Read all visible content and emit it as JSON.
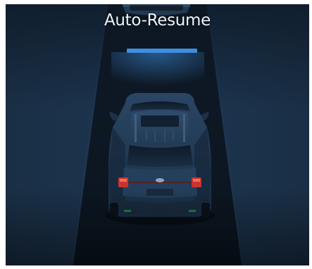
{
  "display": {
    "title": "Auto-Resume",
    "mode": "adaptive-cruise-stop-and-go",
    "gap_indicator_color": "#3e8fe0",
    "icons": [
      "lead-vehicle-icon",
      "own-vehicle-icon",
      "following-distance-bar-icon"
    ]
  }
}
